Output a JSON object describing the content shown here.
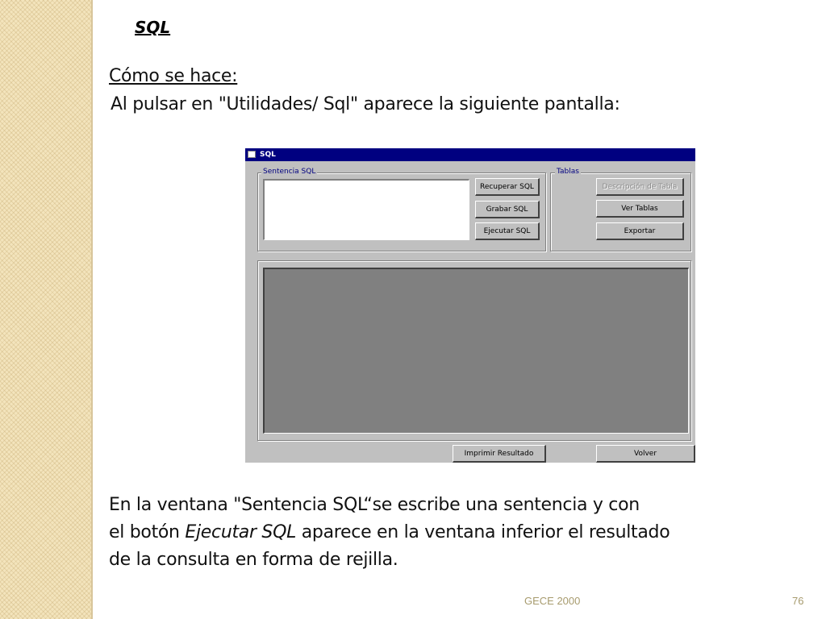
{
  "slide": {
    "title": "SQL",
    "heading": "Cómo se hace:",
    "line1": " Al pulsar en \"Utilidades/ Sql\" aparece la siguiente pantalla:",
    "para_line1": "En la ventana \"Sentencia SQL“se escribe una sentencia y con",
    "para_line2_before": "el botón ",
    "para_line2_em": "Ejecutar SQL",
    "para_line2_after": " aparece en la ventana inferior el resultado",
    "para_line3": "de la consulta en forma de rejilla."
  },
  "dialog": {
    "title": "SQL",
    "group_sentencia": "Sentencia SQL",
    "group_tablas": "Tablas",
    "sql_value": "",
    "btn_recuperar": "Recuperar SQL",
    "btn_grabar": "Grabar SQL",
    "btn_ejecutar": "Ejecutar SQL",
    "btn_descripcion": "Descripción de Tabla",
    "btn_ver": "Ver Tablas",
    "btn_exportar": "Exportar",
    "btn_imprimir": "Imprimir Resultado",
    "btn_volver": "Volver"
  },
  "footer": {
    "left": "GECE 2000",
    "page": "76"
  },
  "colors": {
    "titlebar": "#000080",
    "dialog_bg": "#c0c0c0",
    "grid_bg": "#808080",
    "side_strip": "#f3e4bc",
    "footer_text": "#a79b6e"
  }
}
